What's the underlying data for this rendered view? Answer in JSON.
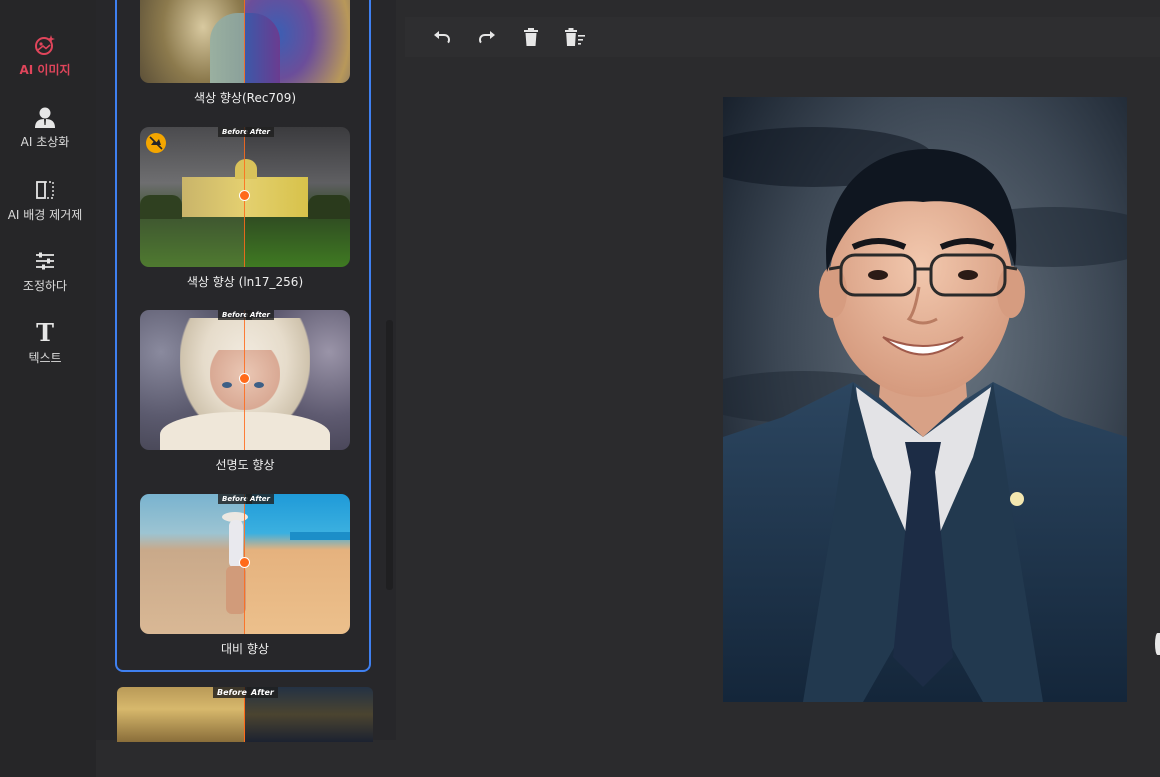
{
  "sidebar": {
    "items": [
      {
        "label": "AI 이미지",
        "icon": "ai-image-icon",
        "active": true
      },
      {
        "label": "AI 초상화",
        "icon": "portrait-icon",
        "active": false
      },
      {
        "label": "AI 배경 제거제",
        "icon": "background-remove-icon",
        "active": false
      },
      {
        "label": "조정하다",
        "icon": "sliders-icon",
        "active": false
      },
      {
        "label": "텍스트",
        "icon": "text-icon",
        "active": false
      }
    ]
  },
  "panel": {
    "before_label": "Before",
    "after_label": "After",
    "cards": [
      {
        "label": "색상 향상(Rec709)"
      },
      {
        "label": "색상 향상 (ln17_256)",
        "badge": "premium-badge-icon"
      },
      {
        "label": "선명도 향상"
      },
      {
        "label": "대비 향상"
      }
    ]
  },
  "toolbar": {
    "buttons": [
      "undo-icon",
      "redo-icon",
      "delete-icon",
      "clear-all-icon"
    ]
  },
  "colors": {
    "accent": "#e0455b",
    "selection_border": "#3f80f0",
    "compare_divider": "#ff6a1a",
    "background": "#2b2b2d"
  }
}
